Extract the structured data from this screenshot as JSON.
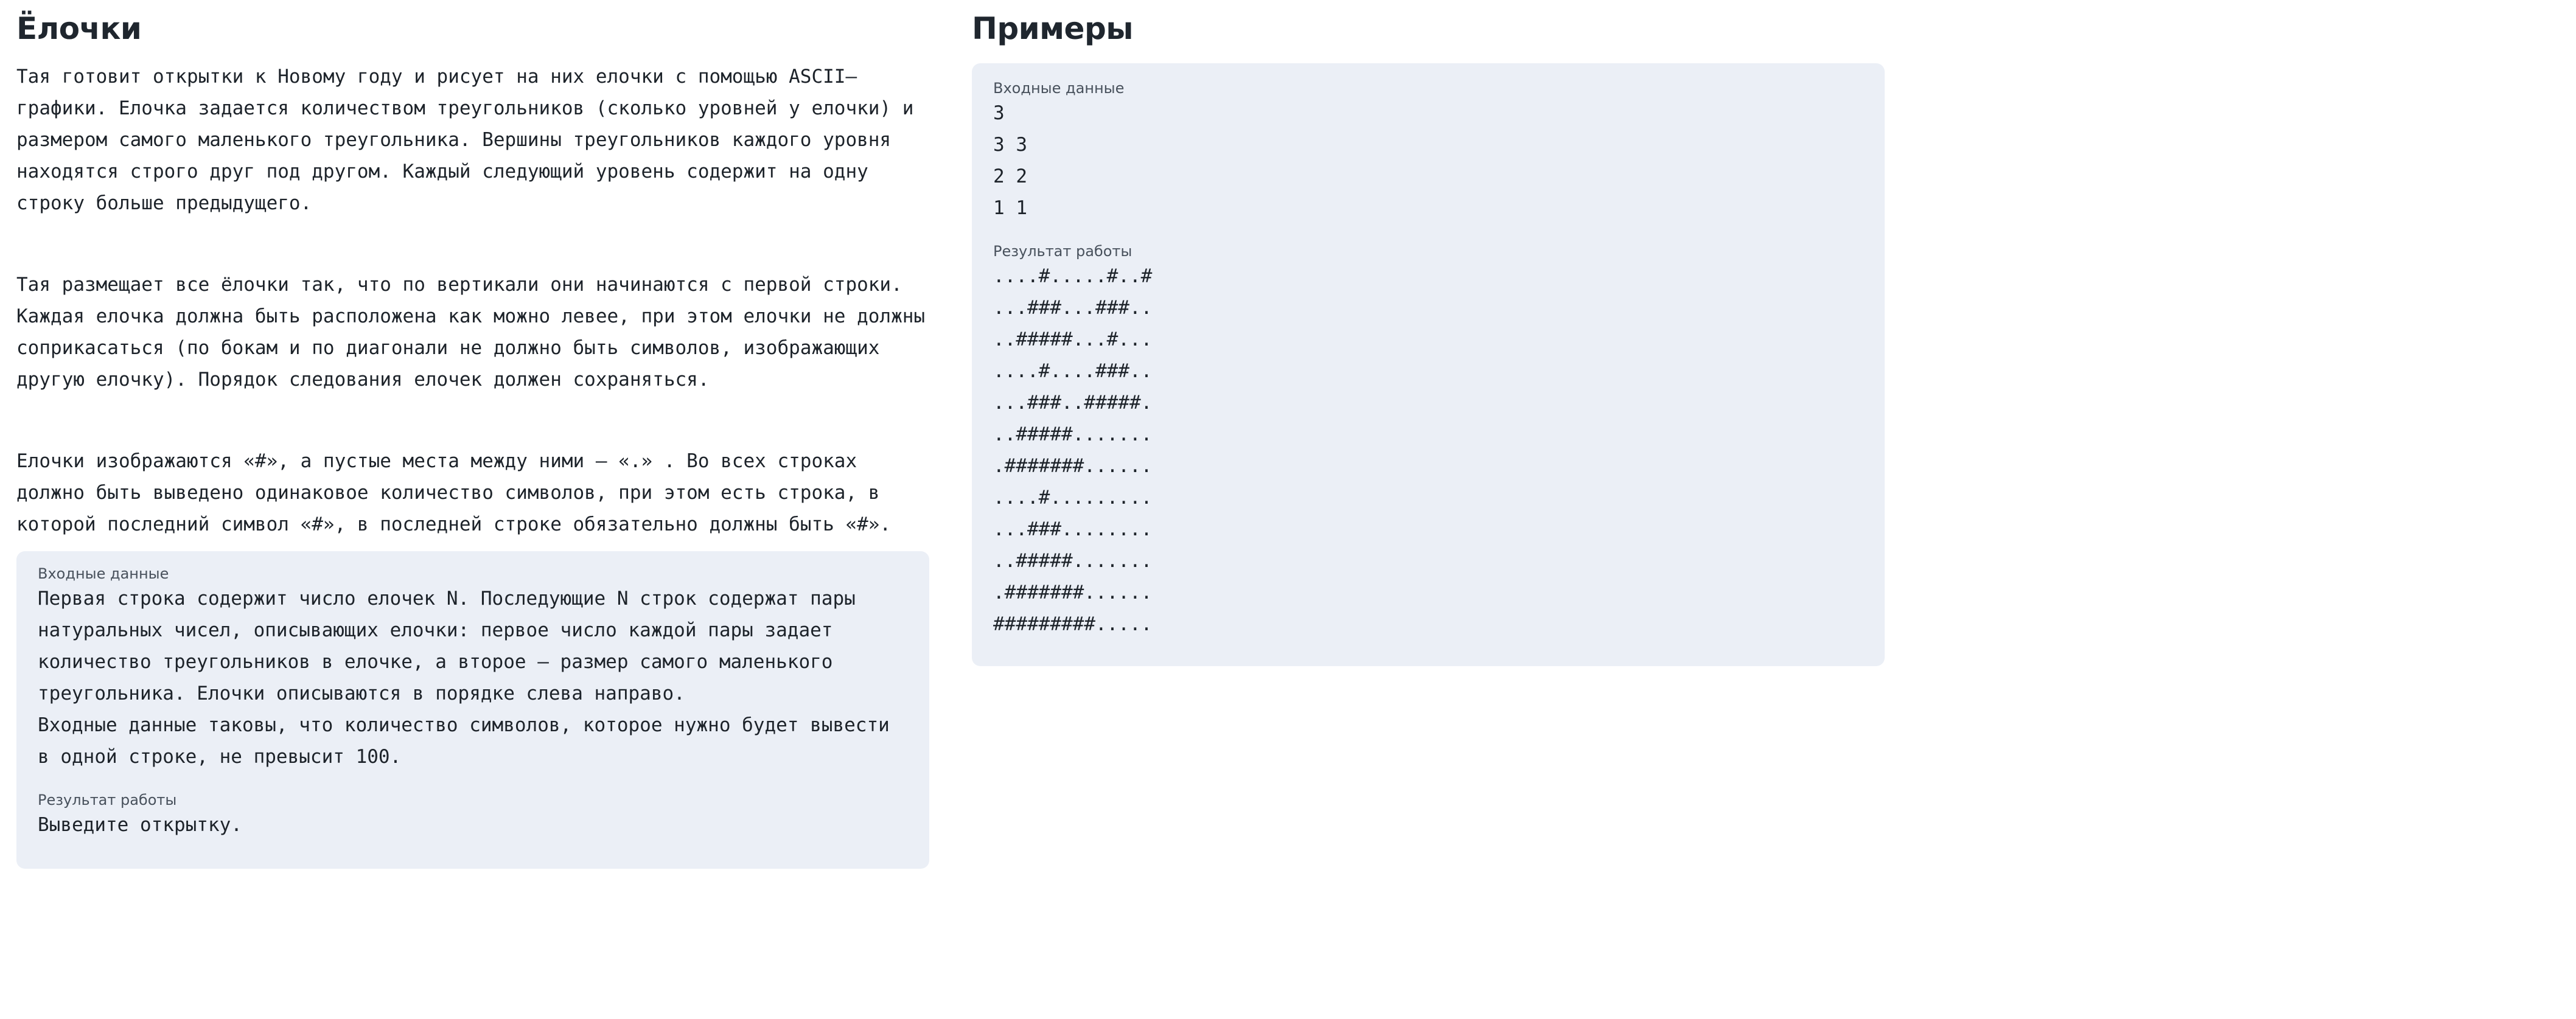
{
  "problem": {
    "title": "Ёлочки",
    "paragraphs": [
      "Тая готовит открытки к Новому году и рисует на них елочки с помощью ASCII–графики. Елочка задается количеством треугольников (сколько уровней у елочки) и размером самого маленького треугольника. Вершины треугольников каждого уровня находятся строго друг под другом. Каждый следующий уровень содержит на одну строку больше предыдущего.",
      "Тая размещает все ёлочки так, что по вертикали они начинаются с первой строки. Каждая елочка должна быть расположена как можно левее, при этом елочки не должны соприкасаться (по бокам и по диагонали не должно быть символов, изображающих другую елочку). Порядок следования елочек должен сохраняться.",
      "Елочки изображаются «#», а пустые места между ними — «.» . Во всех строках должно быть выведено одинаковое количество символов, при этом есть строка, в которой последний символ «#», в последней строке обязательно должны быть «#»."
    ],
    "input_label": "Входные данные",
    "input_text": "Первая строка содержит число елочек N. Последующие N строк содержат пары натуральных чисел, описывающих елочки: первое число каждой пары задает количество треугольников в елочке, а второе — размер самого маленького треугольника. Елочки описываются в порядке слева направо.\nВходные данные таковы, что количество символов, которое нужно будет вывести в одной строке, не превысит 100.",
    "output_label": "Результат работы",
    "output_text": "Выведите открытку."
  },
  "examples": {
    "title": "Примеры",
    "input_label": "Входные данные",
    "input_text": "3\n3 3\n2 2\n1 1",
    "output_label": "Результат работы",
    "output_text": "....#.....#..#\n...###...###..\n..#####...#...\n....#....###..\n...###..#####.\n..#####.......\n.#######......\n....#.........\n...###........\n..#####.......\n.#######......\n#########....."
  }
}
